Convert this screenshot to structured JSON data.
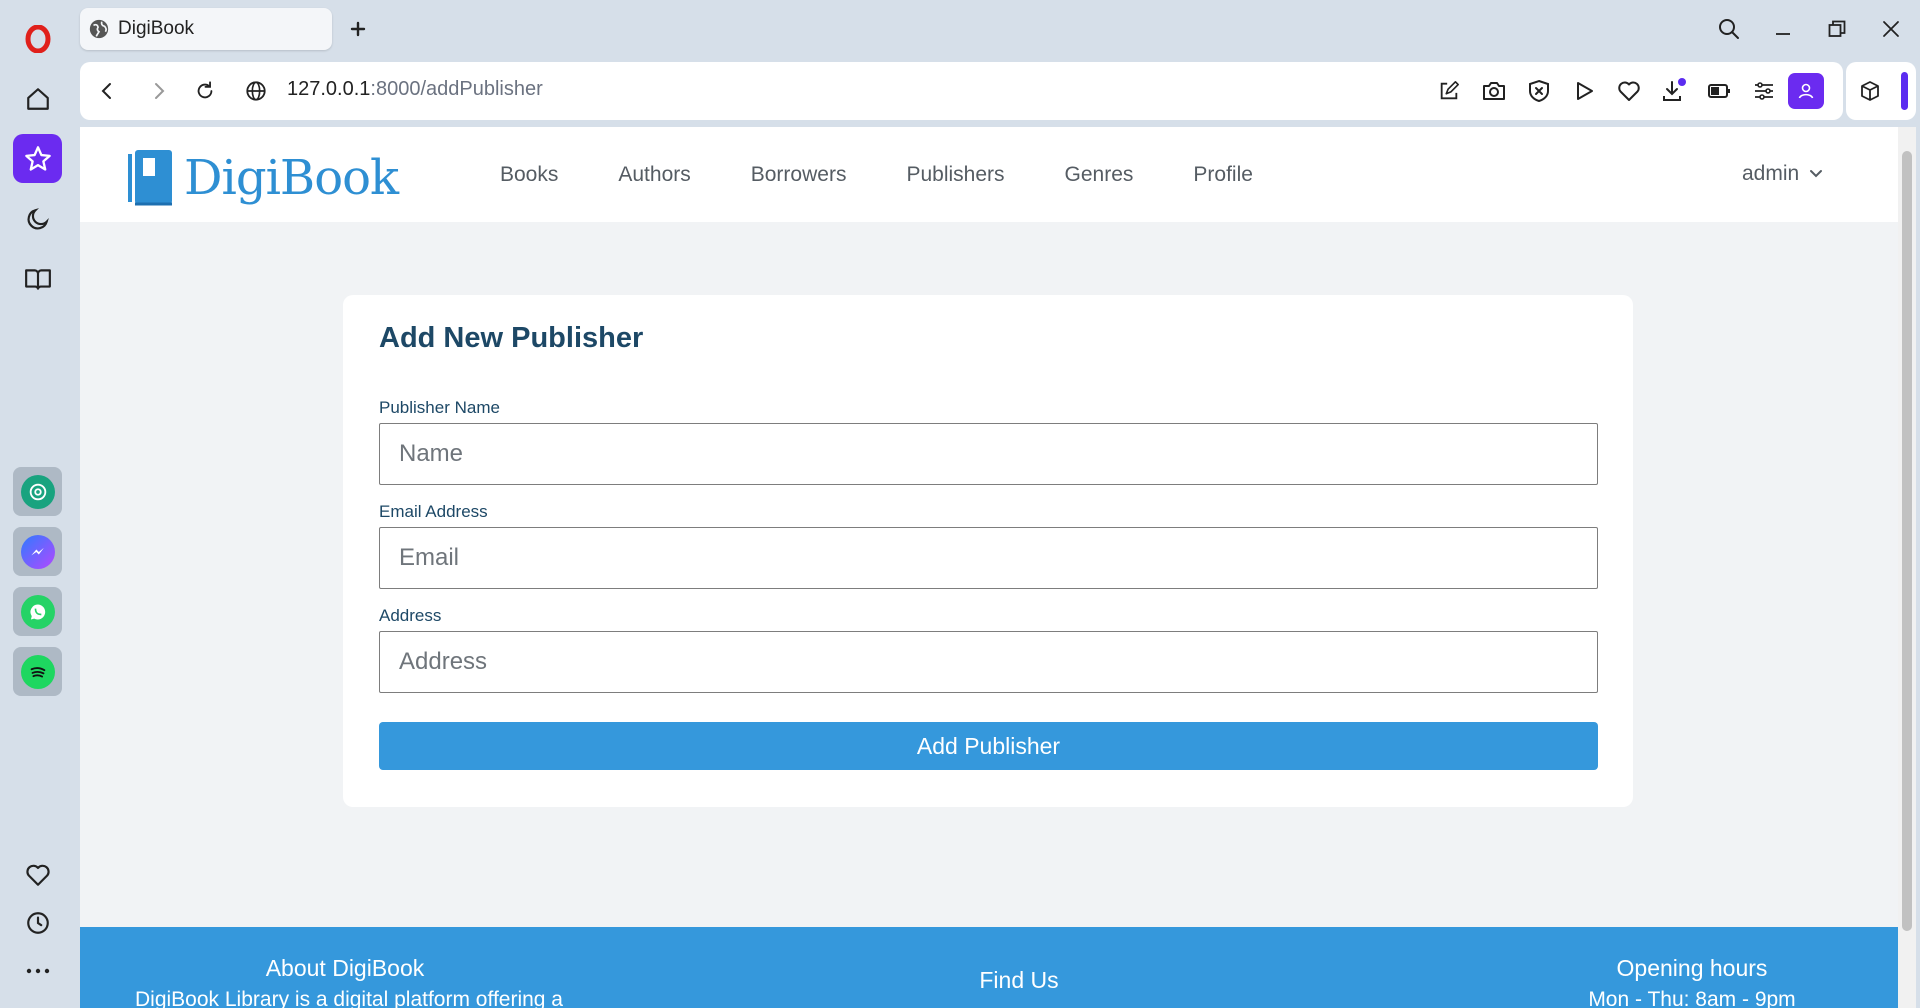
{
  "browser": {
    "tab_title": "DigiBook",
    "url_host": "127.0.0.1",
    "url_path": ":8000/addPublisher"
  },
  "site": {
    "logo_text": "DigiBook",
    "nav": [
      "Books",
      "Authors",
      "Borrowers",
      "Publishers",
      "Genres",
      "Profile"
    ],
    "user_menu_label": "admin"
  },
  "form": {
    "title": "Add New Publisher",
    "name_label": "Publisher Name",
    "name_placeholder": "Name",
    "email_label": "Email Address",
    "email_placeholder": "Email",
    "address_label": "Address",
    "address_placeholder": "Address",
    "submit_label": "Add Publisher"
  },
  "footer": {
    "about_title": "About DigiBook",
    "about_text": "DigiBook Library is a digital platform offering a",
    "find_title": "Find Us",
    "hours_title": "Opening hours",
    "hours_text": "Mon - Thu: 8am - 9pm"
  },
  "colors": {
    "accent": "#3598dc",
    "heading": "#1d4866",
    "opera_purple": "#6b2bf0"
  }
}
